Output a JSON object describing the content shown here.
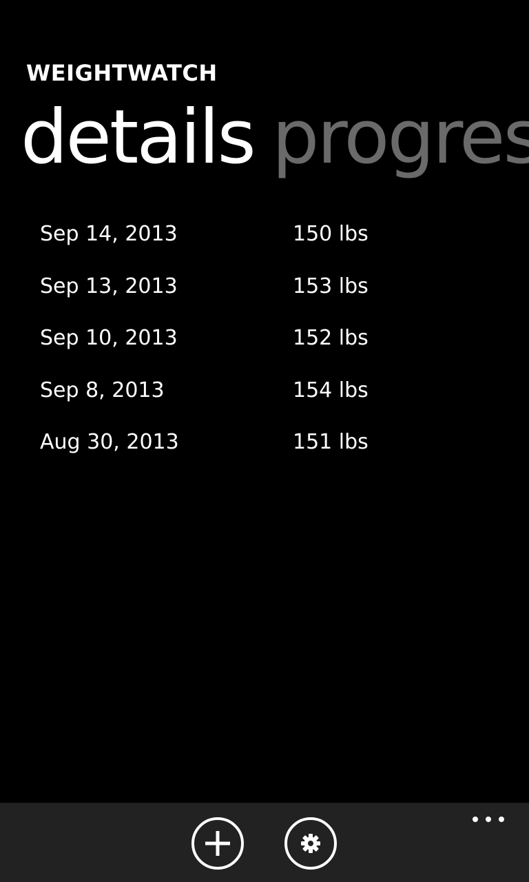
{
  "app": {
    "title": "WEIGHTWATCH"
  },
  "pivot": {
    "items": [
      {
        "label": "details",
        "active": true
      },
      {
        "label": "progres",
        "active": false
      }
    ]
  },
  "entries": [
    {
      "date": "Sep 14, 2013",
      "weight": "150 lbs"
    },
    {
      "date": "Sep 13, 2013",
      "weight": "153 lbs"
    },
    {
      "date": "Sep 10, 2013",
      "weight": "152 lbs"
    },
    {
      "date": "Sep 8, 2013",
      "weight": "154 lbs"
    },
    {
      "date": "Aug 30, 2013",
      "weight": "151 lbs"
    }
  ],
  "app_bar": {
    "buttons": [
      {
        "icon": "add-icon"
      },
      {
        "icon": "gear-icon"
      }
    ],
    "more_icon": "ellipsis-icon"
  },
  "colors": {
    "background": "#000000",
    "text": "#ffffff",
    "inactive_pivot": "#6a6a6a",
    "app_bar": "#222222"
  }
}
